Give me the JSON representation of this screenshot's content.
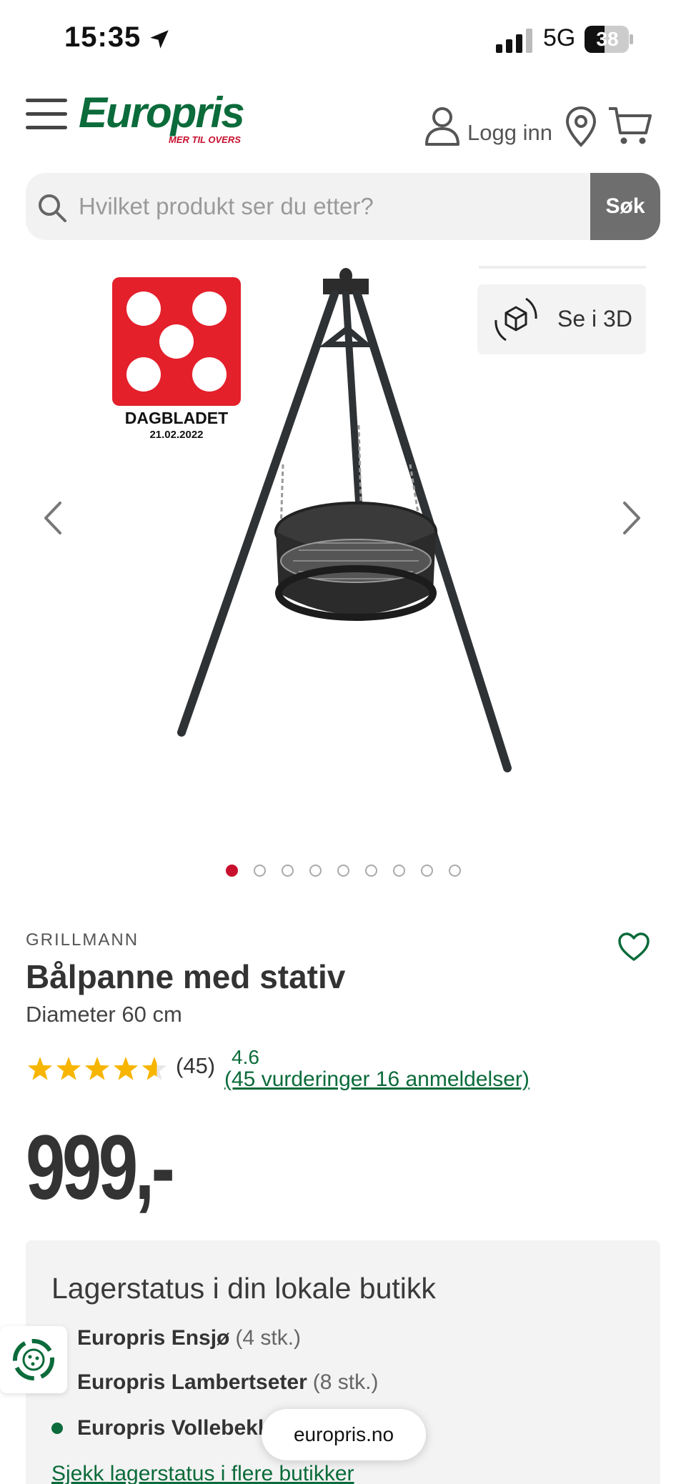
{
  "status_bar": {
    "time": "15:35",
    "network": "5G",
    "battery": "38"
  },
  "header": {
    "logo_text": "Europris",
    "logo_tagline": "MER TIL OVERS",
    "login_label": "Logg inn"
  },
  "search": {
    "placeholder": "Hvilket produkt ser du etter?",
    "button_label": "Søk"
  },
  "gallery": {
    "view3d_label": "Se i 3D",
    "badge_name": "DAGBLADET",
    "badge_date": "21.02.2022",
    "badge_score": 5,
    "image_count": 9,
    "active_index": 0
  },
  "product": {
    "brand": "GRILLMANN",
    "title": "Bålpanne med stativ",
    "subtitle": "Diameter 60 cm",
    "rating": 4.6,
    "review_count": "(45)",
    "rating_value": "4.6",
    "rating_link": "(45 vurderinger 16 anmeldelser)",
    "price": "999,-"
  },
  "stock": {
    "title": "Lagerstatus i din lokale butikk",
    "stores": [
      {
        "name": "Europris Ensjø",
        "qty": "(4 stk.)"
      },
      {
        "name": "Europris Lambertseter",
        "qty": "(8 stk.)"
      },
      {
        "name": "Europris Vollebekk",
        "qty": ""
      }
    ],
    "link": "Sjekk lagerstatus i flere butikker"
  },
  "browser": {
    "url": "europris.no"
  },
  "colors": {
    "brand_green": "#0b6b3a",
    "brand_red": "#c8102e",
    "star_yellow": "#f7b500"
  }
}
